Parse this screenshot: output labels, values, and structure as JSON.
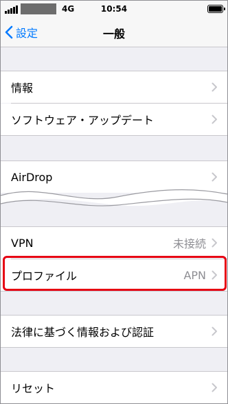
{
  "status_bar": {
    "network": "4G",
    "time": "10:54"
  },
  "nav": {
    "back_label": "設定",
    "title": "一般"
  },
  "rows": {
    "info": {
      "label": "情報"
    },
    "software_update": {
      "label": "ソフトウェア・アップデート"
    },
    "airdrop": {
      "label": "AirDrop"
    },
    "vpn": {
      "label": "VPN",
      "value": "未接続"
    },
    "profile": {
      "label": "プロファイル",
      "value": "APN"
    },
    "legal": {
      "label": "法律に基づく情報および認証"
    },
    "reset": {
      "label": "リセット"
    }
  },
  "colors": {
    "accent": "#007aff",
    "highlight": "#e60012",
    "grouped_background": "#efeff4",
    "secondary_text": "#8e8e93"
  }
}
